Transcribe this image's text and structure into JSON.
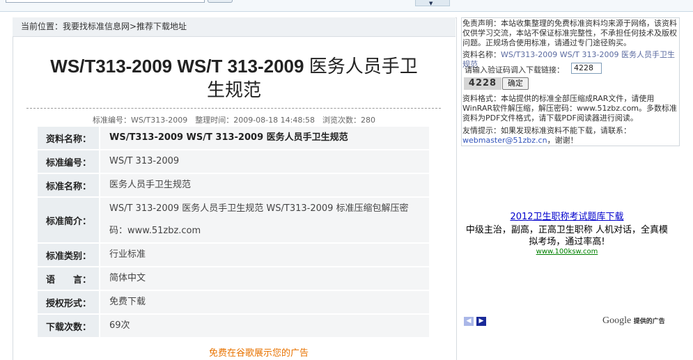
{
  "breadcrumb": "当前位置：我要找标准信息网>推荐下载地址",
  "title": {
    "code": "WS/T313-2009 WS/T 313-2009",
    "name_line1": "医务人员手卫",
    "name_line2": "生规范"
  },
  "meta": "标准编号：WS/T313-2009　整理时间：2009-08-18 14:48:58　浏览次数：280",
  "info_rows": [
    {
      "label": "资料名称：",
      "value": "WS/T313-2009 WS/T 313-2009 医务人员手卫生规范"
    },
    {
      "label": "标准编号：",
      "value": "WS/T 313-2009"
    },
    {
      "label": "标准名称：",
      "value": "医务人员手卫生规范"
    },
    {
      "label": "标准简介：",
      "value": "WS/T 313-2009 医务人员手卫生规范 WS/T313-2009 标准压缩包解压密码：www.51zbz.com"
    },
    {
      "label": "标准类别：",
      "value": "行业标准"
    },
    {
      "label": "语　　言：",
      "value": "简体中文"
    },
    {
      "label": "授权形式：",
      "value": "免费下载"
    },
    {
      "label": "下载次数：",
      "value": "69次"
    }
  ],
  "ad_link": "免费在谷歌展示您的广告",
  "sidebar": {
    "disclaimer": "免责声明：本站收集整理的免费标准资料均来源于网络，该资料仅供学习交流，本站不保证标准完整性，不承担任何技术及版权问题。正规场合使用标准，请通过专门途径购买。",
    "doc_label": "资料名称：",
    "doc_name": "WS/T313-2009 WS/T 313-2009 医务人员手卫生规范",
    "code_label": "请输入验证码调入下载链接：",
    "code_value": "4228",
    "captcha": "4228",
    "confirm": "确定",
    "format_note": "资料格式：本站提供的标准全部压缩成RAR文件，请使用WinRAR软件解压缩，解压密码：www.51zbz.com。多数标准资料为PDF文件格式，请下载PDF阅读器进行阅读。",
    "tip_label": "友情提示：如果发现标准资料不能下载，请联系：",
    "tip_email": "webmaster@51zbz.cn",
    "tip_end": "，谢谢！"
  },
  "right_ad": {
    "title": "2012卫生职称考试题库下载",
    "desc": "中级主治，副高，正高卫生职称 人机对话，全真模拟考场，通过率高!",
    "url": "www.100ksw.com",
    "google": "Google",
    "google_suffix": "提供的广告"
  },
  "colors": {
    "accent_orange": "#e87300",
    "link_blue": "#0000cc",
    "ad_green": "#008000"
  }
}
